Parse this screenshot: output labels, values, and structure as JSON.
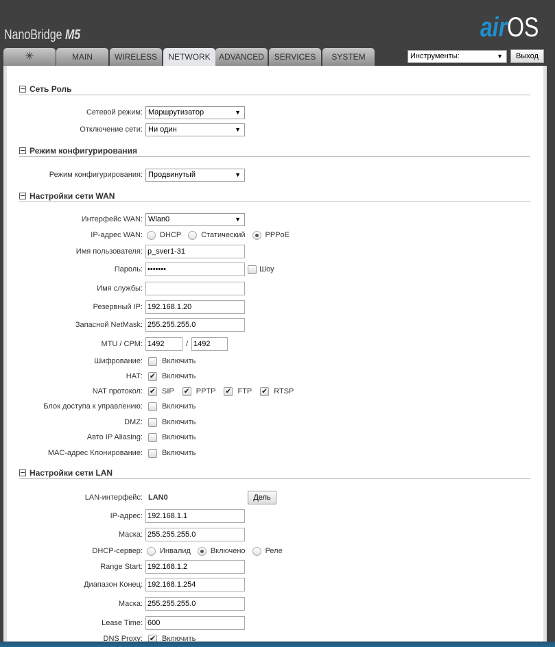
{
  "header": {
    "brand": "NanoBridge",
    "brand_model": "M5",
    "logo_air": "air",
    "logo_os": "OS"
  },
  "tabs": [
    {
      "label": "MAIN"
    },
    {
      "label": "WIRELESS"
    },
    {
      "label": "NETWORK",
      "active": true
    },
    {
      "label": "ADVANCED"
    },
    {
      "label": "SERVICES"
    },
    {
      "label": "SYSTEM"
    }
  ],
  "tools": {
    "selected": "Инструменты:",
    "logout": "Выход"
  },
  "network_role": {
    "title": "Сеть Роль",
    "mode_label": "Сетевой режим:",
    "mode": "Маршрутизатор",
    "disable_label": "Отключение сети:",
    "disable": "Ни один"
  },
  "config_mode": {
    "title": "Режим конфигурирования",
    "label": "Режим конфигурирования:",
    "value": "Продвинутый"
  },
  "wan": {
    "title": "Настройки сети WAN",
    "interface_label": "Интерфейс WAN:",
    "interface": "Wlan0",
    "ip_label": "IP-адрес WAN:",
    "ip_options": [
      "DHCP",
      "Статический",
      "PPPoE"
    ],
    "ip_selected": "PPPoE",
    "user_label": "Имя пользователя:",
    "user": "p_sver1-31",
    "password_label": "Пароль:",
    "password": "•••••••",
    "show_label": "Шоу",
    "service_label": "Имя службы:",
    "service": "",
    "fallback_ip_label": "Резервный IP:",
    "fallback_ip": "192.168.1.20",
    "fallback_mask_label": "Запасной NetMask:",
    "fallback_mask": "255.255.255.0",
    "mtu_label": "MTU / CPM:",
    "mtu": "1492",
    "mru": "1492",
    "mtu_sep": "/",
    "enable_label": "Включить",
    "encryption_label": "Шифрование:",
    "nat_label": "НАТ:",
    "nat_proto_label": "NAT протокол:",
    "nat_protocols": [
      "SIP",
      "PPTP",
      "FTP",
      "RTSP"
    ],
    "block_label": "Блок доступа к управлению:",
    "dmz_label": "DMZ:",
    "alias_label": "Авто IP Aliasing:",
    "mac_label": "MAC-адрес Клонирование:"
  },
  "lan": {
    "title": "Настройки сети LAN",
    "iface_label": "LAN-интерфейс:",
    "iface": "LAN0",
    "split_label": "Дель",
    "ip_label": "IP-адрес:",
    "ip": "192.168.1.1",
    "mask_label": "Маска:",
    "mask": "255.255.255.0",
    "dhcp_label": "DHCP-сервер:",
    "dhcp_options": [
      "Инвалид",
      "Включено",
      "Реле"
    ],
    "dhcp_selected": "Включено",
    "start_label": "Range Start:",
    "start": "192.168.1.2",
    "end_label": "Диапазон Конец:",
    "end": "192.168.1.254",
    "mask2_label": "Маска:",
    "mask2": "255.255.255.0",
    "lease_label": "Lease Time:",
    "lease": "600",
    "dns_label": "DNS Proxy:",
    "enable_label": "Включить"
  }
}
